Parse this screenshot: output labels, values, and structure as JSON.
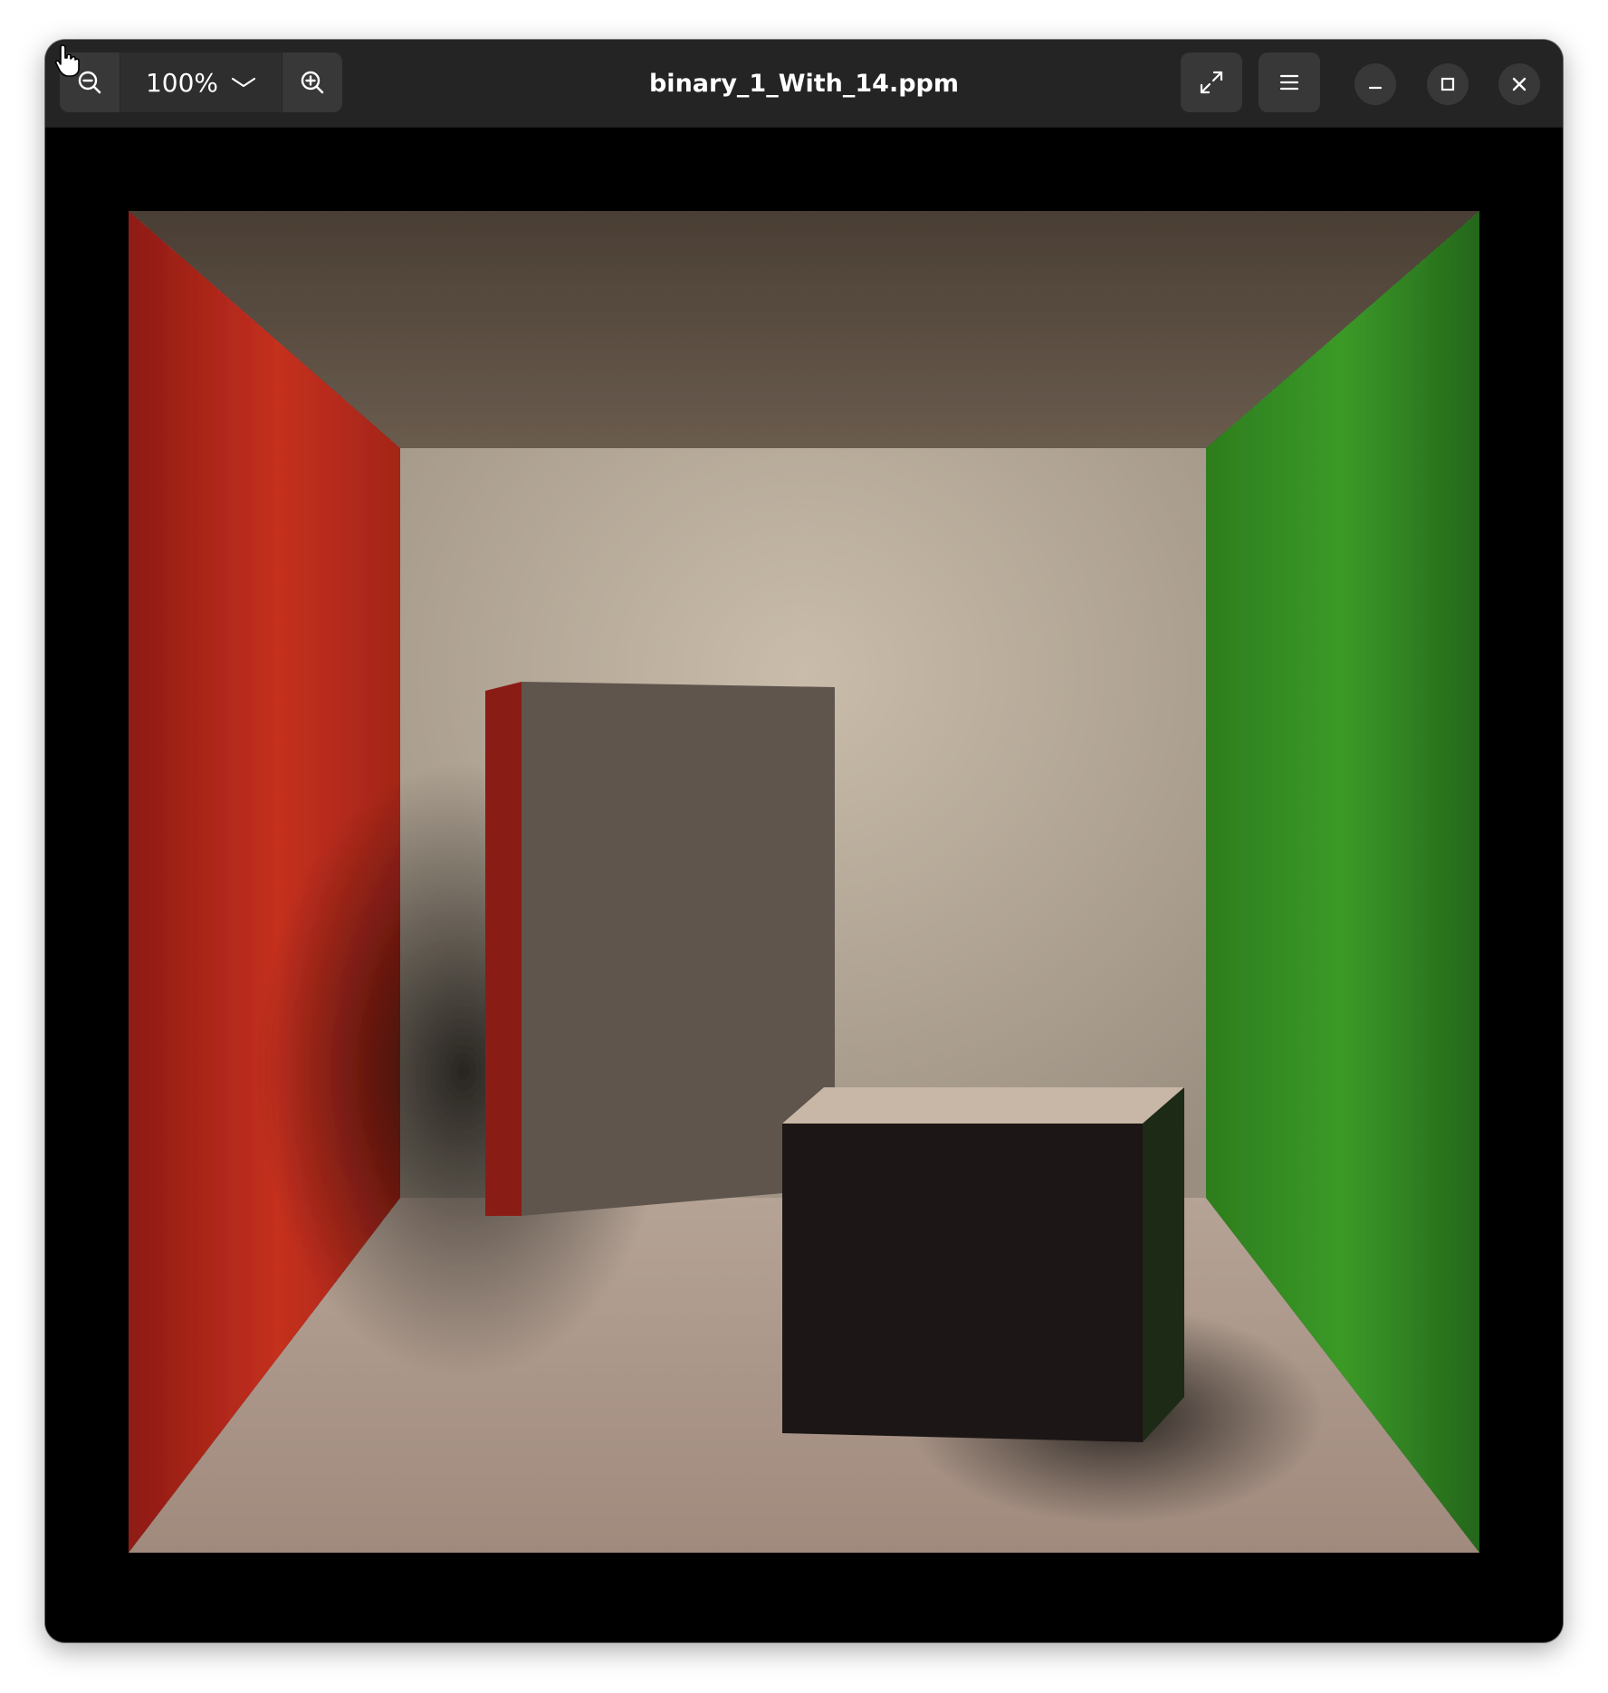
{
  "window": {
    "title": "binary_1_With_14.ppm"
  },
  "toolbar": {
    "zoom_level": "100%",
    "zoom_out_icon": "zoom-out-icon",
    "zoom_in_icon": "zoom-in-icon",
    "zoom_dropdown_icon": "chevron-down-icon",
    "fullscreen_icon": "fullscreen-icon",
    "menu_icon": "hamburger-menu-icon"
  },
  "window_controls": {
    "minimize_icon": "minimize-icon",
    "maximize_icon": "maximize-icon",
    "close_icon": "close-icon"
  },
  "image": {
    "description_icon": "cornell-box-render",
    "colors": {
      "left_wall": "#c0281c",
      "right_wall": "#2f8a1e",
      "back_wall": "#b8aa98",
      "floor": "#b09c90",
      "ceiling": "#5a4c40"
    }
  },
  "theme": {
    "headerbar_bg": "#242424",
    "button_bg": "#383838",
    "text": "#ffffff"
  }
}
